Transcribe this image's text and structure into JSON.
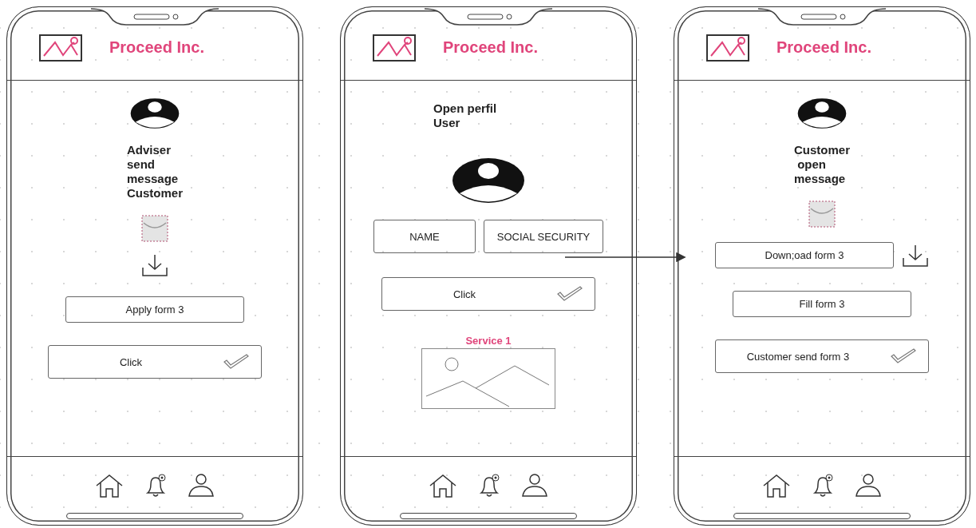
{
  "phones": [
    {
      "brand": "Proceed Inc.",
      "items": [
        {
          "kind": "avatar"
        },
        {
          "kind": "heading",
          "text": "Adviser\nsend\nmessage\nCustomer"
        },
        {
          "kind": "envelope"
        },
        {
          "kind": "download"
        },
        {
          "kind": "button",
          "text": "Apply form 3",
          "check": false,
          "download": false,
          "wide": false
        },
        {
          "kind": "button",
          "text": "Click",
          "check": true,
          "download": false,
          "wide": true
        }
      ]
    },
    {
      "brand": "Proceed Inc.",
      "items": [
        {
          "kind": "heading",
          "text": "Open perfil\nUser"
        },
        {
          "kind": "avatar-large"
        },
        {
          "kind": "fields",
          "values": [
            "NAME",
            "SOCIAL SECURITY"
          ]
        },
        {
          "kind": "button",
          "text": "Click",
          "check": true,
          "download": false,
          "wide": true
        },
        {
          "kind": "label",
          "text": "Service 1"
        },
        {
          "kind": "image"
        }
      ]
    },
    {
      "brand": "Proceed Inc.",
      "items": [
        {
          "kind": "avatar"
        },
        {
          "kind": "heading",
          "text": "Customer\n open\nmessage"
        },
        {
          "kind": "envelope"
        },
        {
          "kind": "button",
          "text": "Down;oad form 3",
          "check": false,
          "download": true,
          "wide": false
        },
        {
          "kind": "button",
          "text": "Fill form 3",
          "check": false,
          "download": false,
          "wide": false
        },
        {
          "kind": "button",
          "text": "Customer send form 3",
          "check": true,
          "download": false,
          "wide": true
        }
      ]
    }
  ]
}
